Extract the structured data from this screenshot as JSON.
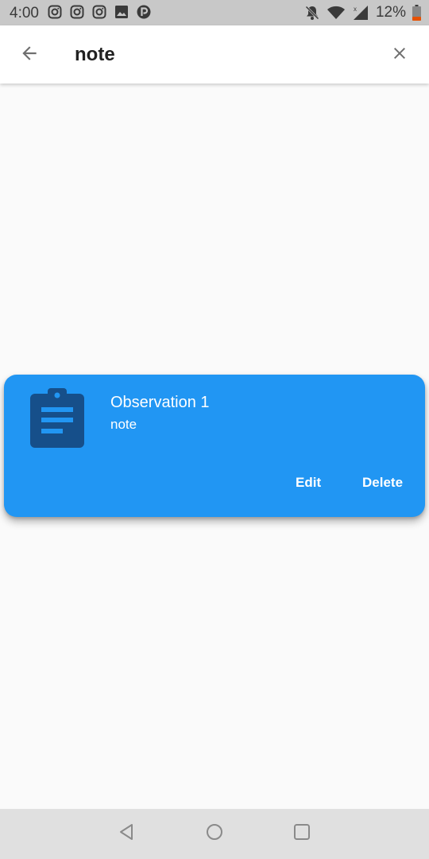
{
  "status_bar": {
    "time": "4:00",
    "battery_percent": "12%",
    "notification_icons": [
      "instagram-icon",
      "instagram-icon",
      "instagram-icon",
      "image-icon",
      "p-app-icon"
    ],
    "system_icons": [
      "notifications-off-icon",
      "wifi-icon",
      "cell-signal-icon",
      "battery-low-icon"
    ]
  },
  "app_bar": {
    "search_value": "note",
    "back_icon": "arrow-back-icon",
    "clear_icon": "close-icon"
  },
  "result_card": {
    "title": "Observation 1",
    "subtitle": "note",
    "icon": "clipboard-notes-icon",
    "edit_label": "Edit",
    "delete_label": "Delete",
    "background_color": "#2196f3",
    "icon_color": "#164f8a"
  },
  "nav_bar": {
    "back_icon": "nav-back-triangle-icon",
    "home_icon": "nav-home-circle-icon",
    "recents_icon": "nav-recents-square-icon"
  }
}
